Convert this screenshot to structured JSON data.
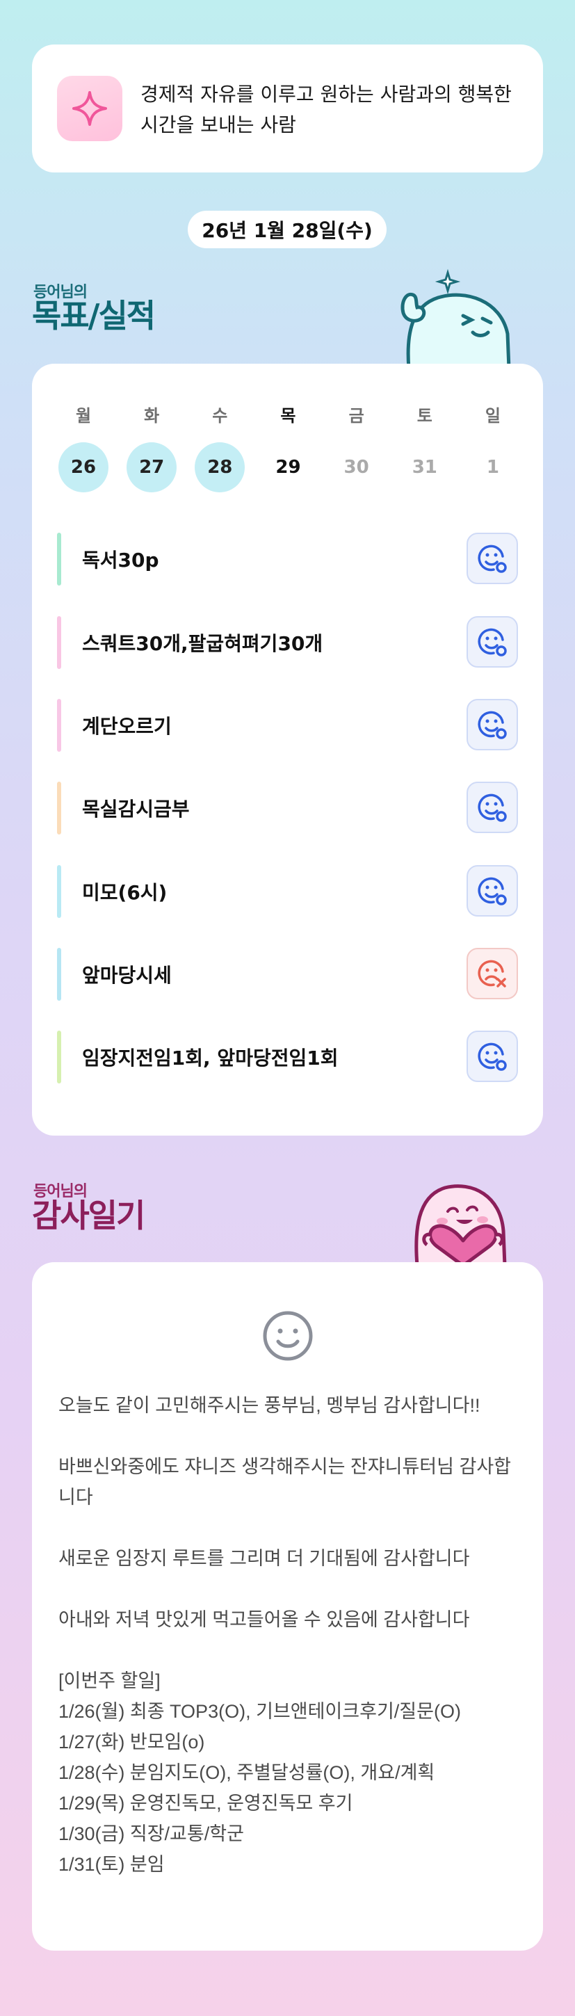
{
  "vision": {
    "text": "경제적 자유를 이루고 원하는 사람과의 행복한 시간을 보내는 사람",
    "icon": "sparkle-icon"
  },
  "date": "26년 1월 28일(수)",
  "goals_section": {
    "subtitle": "등어님의",
    "title": "목표/실적"
  },
  "week": [
    {
      "label": "월",
      "num": "26",
      "state": "done"
    },
    {
      "label": "화",
      "num": "27",
      "state": "done"
    },
    {
      "label": "수",
      "num": "28",
      "state": "done"
    },
    {
      "label": "목",
      "num": "29",
      "state": "today"
    },
    {
      "label": "금",
      "num": "30",
      "state": "future"
    },
    {
      "label": "토",
      "num": "31",
      "state": "future"
    },
    {
      "label": "일",
      "num": "1",
      "state": "future"
    }
  ],
  "goals": [
    {
      "text": "독서30p",
      "color": "#a8ead0",
      "status": "ok"
    },
    {
      "text": "스쿼트30개,팔굽혀펴기30개",
      "color": "#f9c6e4",
      "status": "ok"
    },
    {
      "text": "계단오르기",
      "color": "#f8c7e6",
      "status": "ok"
    },
    {
      "text": "목실감시금부",
      "color": "#fbdcb9",
      "status": "ok"
    },
    {
      "text": "미모(6시)",
      "color": "#b9eaf4",
      "status": "ok"
    },
    {
      "text": "앞마당시세",
      "color": "#b6e6f3",
      "status": "fail"
    },
    {
      "text": "임장지전임1회, 앞마당전임1회",
      "color": "#d6f0b0",
      "status": "ok"
    }
  ],
  "thanks_section": {
    "subtitle": "등어님의",
    "title": "감사일기"
  },
  "thanks": {
    "mood_icon": "smile-face-icon",
    "text": "오늘도 같이 고민해주시는 풍부님, 멩부님 감사합니다!!\n\n바쁘신와중에도 쟈니즈 생각해주시는 잔쟈니튜터님 감사합니다\n\n새로운 임장지 루트를 그리며 더 기대됨에 감사합니다\n\n아내와 저녁 맛있게 먹고들어올 수 있음에 감사합니다\n\n[이번주 할일]\n1/26(월) 최종 TOP3(O), 기브앤테이크후기/질문(O)\n1/27(화) 반모임(o)\n1/28(수) 분임지도(O), 주별달성률(O), 개요/계획\n1/29(목) 운영진독모, 운영진독모 후기\n1/30(금) 직장/교통/학군\n1/31(토) 분임"
  },
  "colors": {
    "accent_blue": "#2f5fe0",
    "fail_red": "#e8604f",
    "goal_title": "#0f6772",
    "thanks_title": "#8c1f5b"
  }
}
